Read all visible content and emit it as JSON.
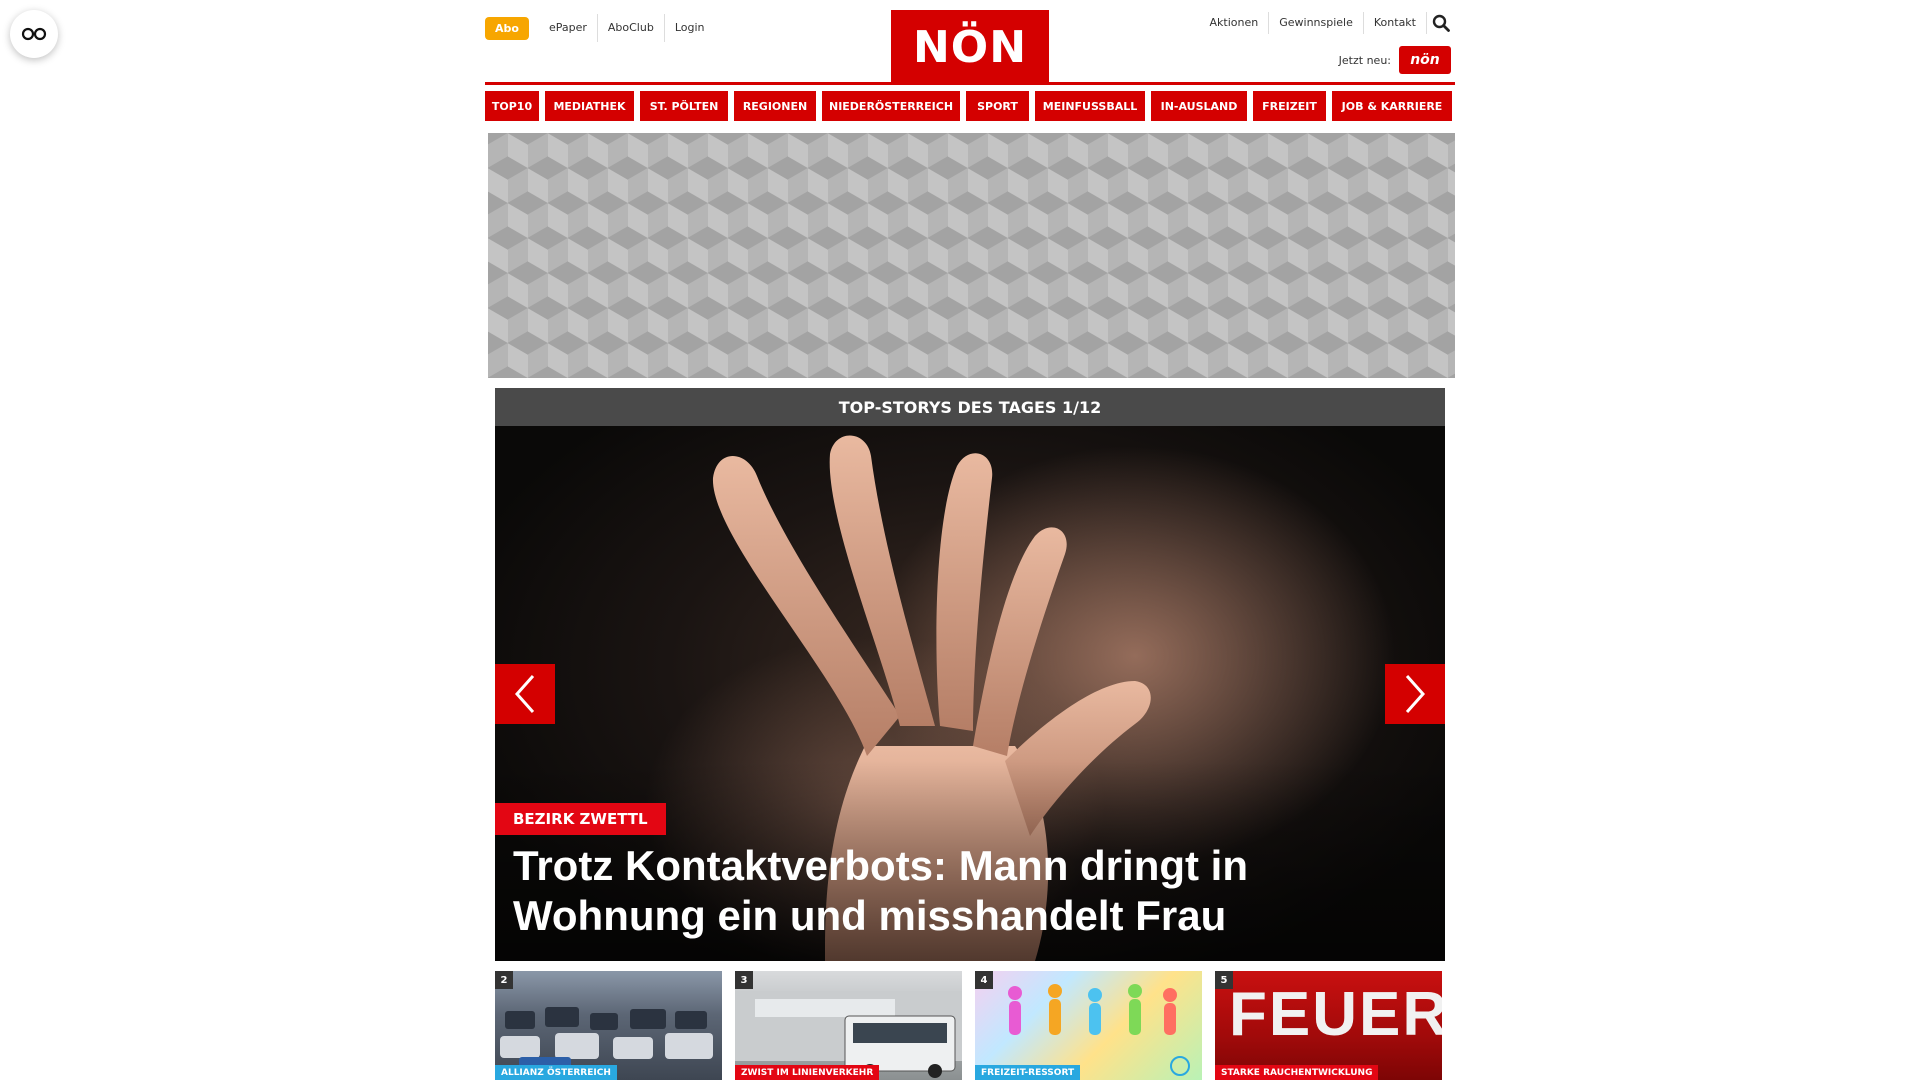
{
  "header": {
    "abo_label": "Abo",
    "top_links": [
      "ePaper",
      "AboClub",
      "Login"
    ],
    "logo_text": "NÖN",
    "right_links": [
      "Aktionen",
      "Gewinnspiele",
      "Kontakt"
    ],
    "jetzt_label": "Jetzt neu:",
    "jetzt_badge_text": "nön"
  },
  "nav": {
    "items": [
      "TOP10",
      "MEDIATHEK",
      "ST. PÖLTEN",
      "REGIONEN",
      "NIEDERÖSTERREICH",
      "SPORT",
      "MEINFUSSBALL",
      "IN-AUSLAND",
      "FREIZEIT",
      "JOB & KARRIERE"
    ]
  },
  "stories": {
    "heading": "TOP-STORYS DES TAGES 1/12",
    "hero": {
      "category": "BEZIRK ZWETTL",
      "title": "Trotz Kontaktverbots: Mann dringt in Wohnung ein und misshandelt Frau"
    },
    "thumbnails": [
      {
        "num": "2",
        "category": "ALLIANZ ÖSTERREICH",
        "cat_color": "#29a8e0"
      },
      {
        "num": "3",
        "category": "ZWIST IM LINIENVERKEHR",
        "cat_color": "#e30613"
      },
      {
        "num": "4",
        "category": "FREIZEIT-RESSORT",
        "cat_color": "#29a8e0"
      },
      {
        "num": "5",
        "category": "STARKE RAUCHENTWICKLUNG",
        "cat_color": "#e30613"
      }
    ],
    "thumb4_overlay": "FEUERW"
  },
  "colors": {
    "brand_red": "#d40000",
    "abo_orange": "#f7a600",
    "header_dark": "#4a4a4a"
  }
}
